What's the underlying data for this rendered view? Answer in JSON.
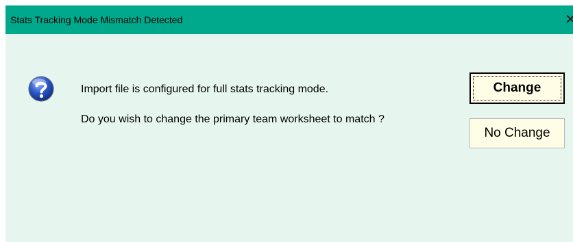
{
  "dialog": {
    "title": "Stats Tracking Mode Mismatch Detected",
    "close_glyph": "✕",
    "icon": "question-icon",
    "message_line1": "Import file is configured for full stats tracking mode.",
    "message_line2": "Do you wish to change the primary team worksheet to match ?",
    "buttons": {
      "change_label": "Change",
      "no_change_label": "No Change"
    }
  },
  "colors": {
    "titlebar": "#00a98c",
    "body": "#e6f6ee",
    "button_face": "#fffde5"
  }
}
